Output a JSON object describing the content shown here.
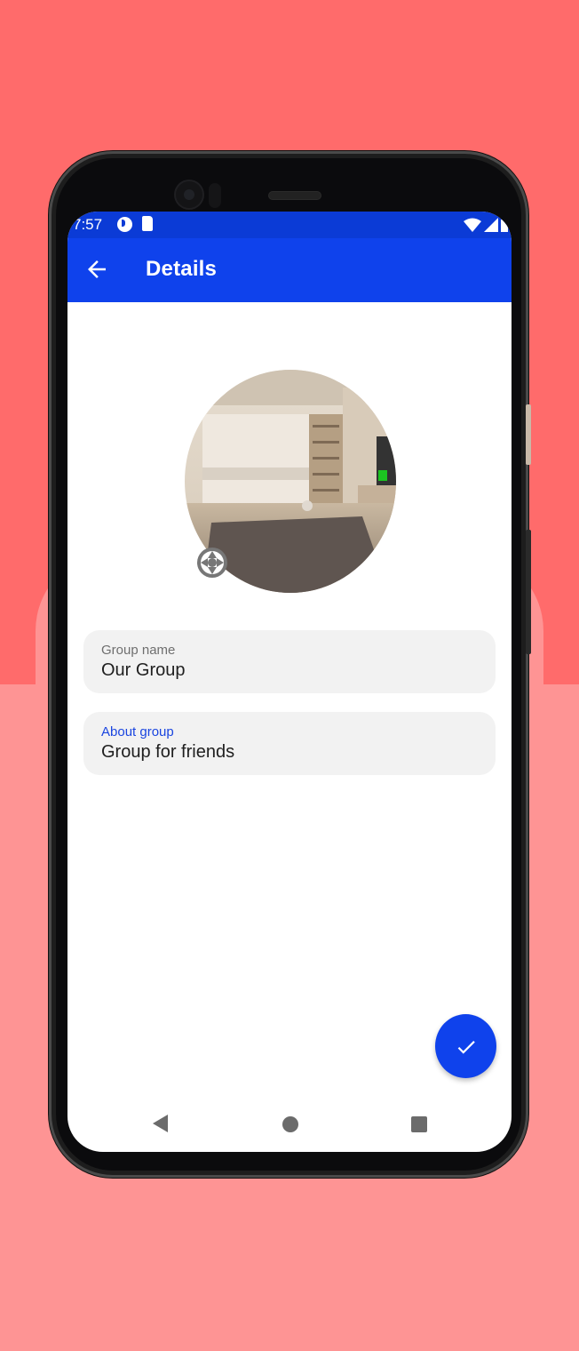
{
  "status_bar": {
    "time": "7:57",
    "icons": [
      "pocket-casts-icon",
      "sd-card-icon",
      "wifi-icon",
      "cell-signal-icon",
      "battery-icon"
    ]
  },
  "app_bar": {
    "title": "Details",
    "back_icon": "arrow-back-icon"
  },
  "avatar": {
    "icon": "camera-shutter-icon"
  },
  "fields": [
    {
      "label": "Group name",
      "value": "Our Group",
      "focused": false
    },
    {
      "label": "About group",
      "value": "Group for friends",
      "focused": true
    }
  ],
  "fab": {
    "icon": "check-icon"
  },
  "nav_bar": {
    "icons": [
      "nav-back-icon",
      "nav-home-icon",
      "nav-recents-icon"
    ]
  },
  "colors": {
    "primary": "#0f42ec",
    "status_bar": "#0b3bd6",
    "background_top": "#ff6b6b",
    "background_bottom": "#fe9494",
    "field_bg": "#f2f2f2",
    "focused_label": "#1a45e0"
  }
}
